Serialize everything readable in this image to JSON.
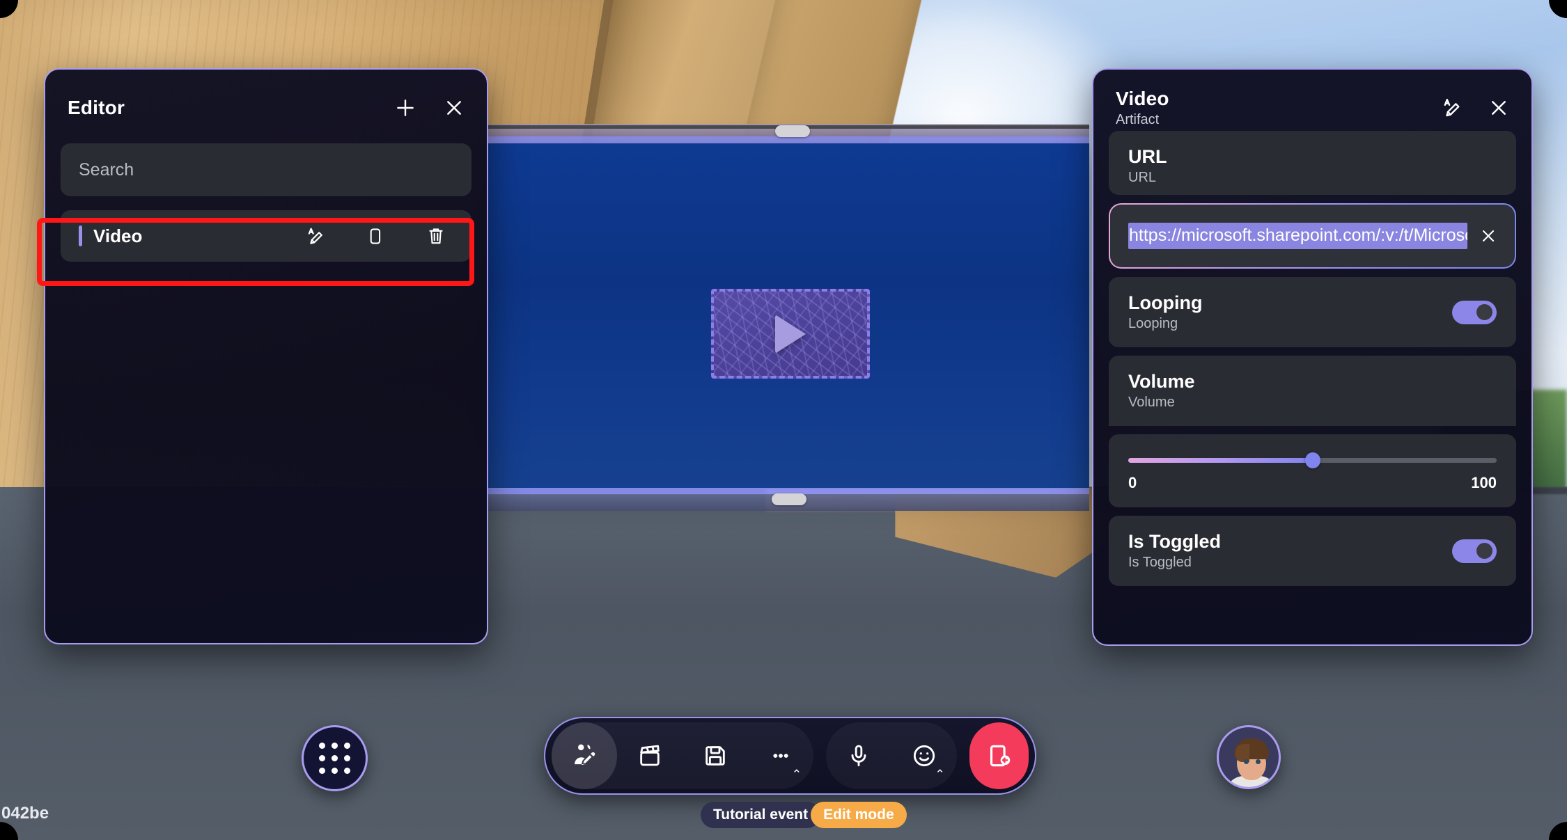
{
  "editor_panel": {
    "title": "Editor",
    "add_icon": "plus-icon",
    "close_icon": "close-icon",
    "search": {
      "placeholder": "Search",
      "value": ""
    },
    "items": [
      {
        "label": "Video",
        "rename_icon": "rename-pencil-icon",
        "duplicate_icon": "duplicate-icon",
        "delete_icon": "trash-icon",
        "highlighted": true
      }
    ]
  },
  "properties_panel": {
    "title": "Video",
    "subtitle": "Artifact",
    "rename_icon": "rename-pencil-icon",
    "close_icon": "close-icon",
    "url": {
      "title": "URL",
      "subtitle": "URL",
      "value": "https://microsoft.sharepoint.com/:v:/t/Microsof",
      "selected": true,
      "clear_icon": "close-icon"
    },
    "looping": {
      "title": "Looping",
      "subtitle": "Looping",
      "state": "on"
    },
    "volume": {
      "title": "Volume",
      "subtitle": "Volume",
      "min_label": "0",
      "max_label": "100",
      "value": 50
    },
    "is_toggled": {
      "title": "Is Toggled",
      "subtitle": "Is Toggled",
      "state": "on"
    }
  },
  "scene": {
    "video_artifact": {
      "name": "video-placeholder",
      "play_icon": "play-icon"
    },
    "handles": [
      "drag-handle-top",
      "drag-handle-bottom"
    ]
  },
  "bottom_bar": {
    "apps_button": "apps-grid-icon",
    "tools": [
      {
        "icon": "edit-avatar-icon",
        "name": "edit-mode-button",
        "active": true
      },
      {
        "icon": "clapperboard-icon",
        "name": "scene-button",
        "active": false
      },
      {
        "icon": "save-icon",
        "name": "save-button",
        "active": false
      },
      {
        "icon": "more-icon",
        "name": "more-button",
        "active": false,
        "chevron": "⌃"
      },
      {
        "icon": "microphone-icon",
        "name": "mic-button",
        "active": false
      },
      {
        "icon": "emoji-icon",
        "name": "reactions-button",
        "active": false,
        "chevron": "⌃"
      }
    ],
    "leave_button": {
      "icon": "leave-icon",
      "name": "leave-button"
    },
    "avatar": "user-avatar"
  },
  "status": {
    "event_label": "Tutorial event",
    "mode_label": "Edit mode",
    "session_id": "042be"
  },
  "colors": {
    "accent_purple": "#a99cf0",
    "toggle_on": "#8b86e8",
    "leave_red": "#f53b5c",
    "edit_mode_orange": "#f7ab48",
    "highlight_red": "#ff1616",
    "selection_blue": "#8a85e0"
  }
}
